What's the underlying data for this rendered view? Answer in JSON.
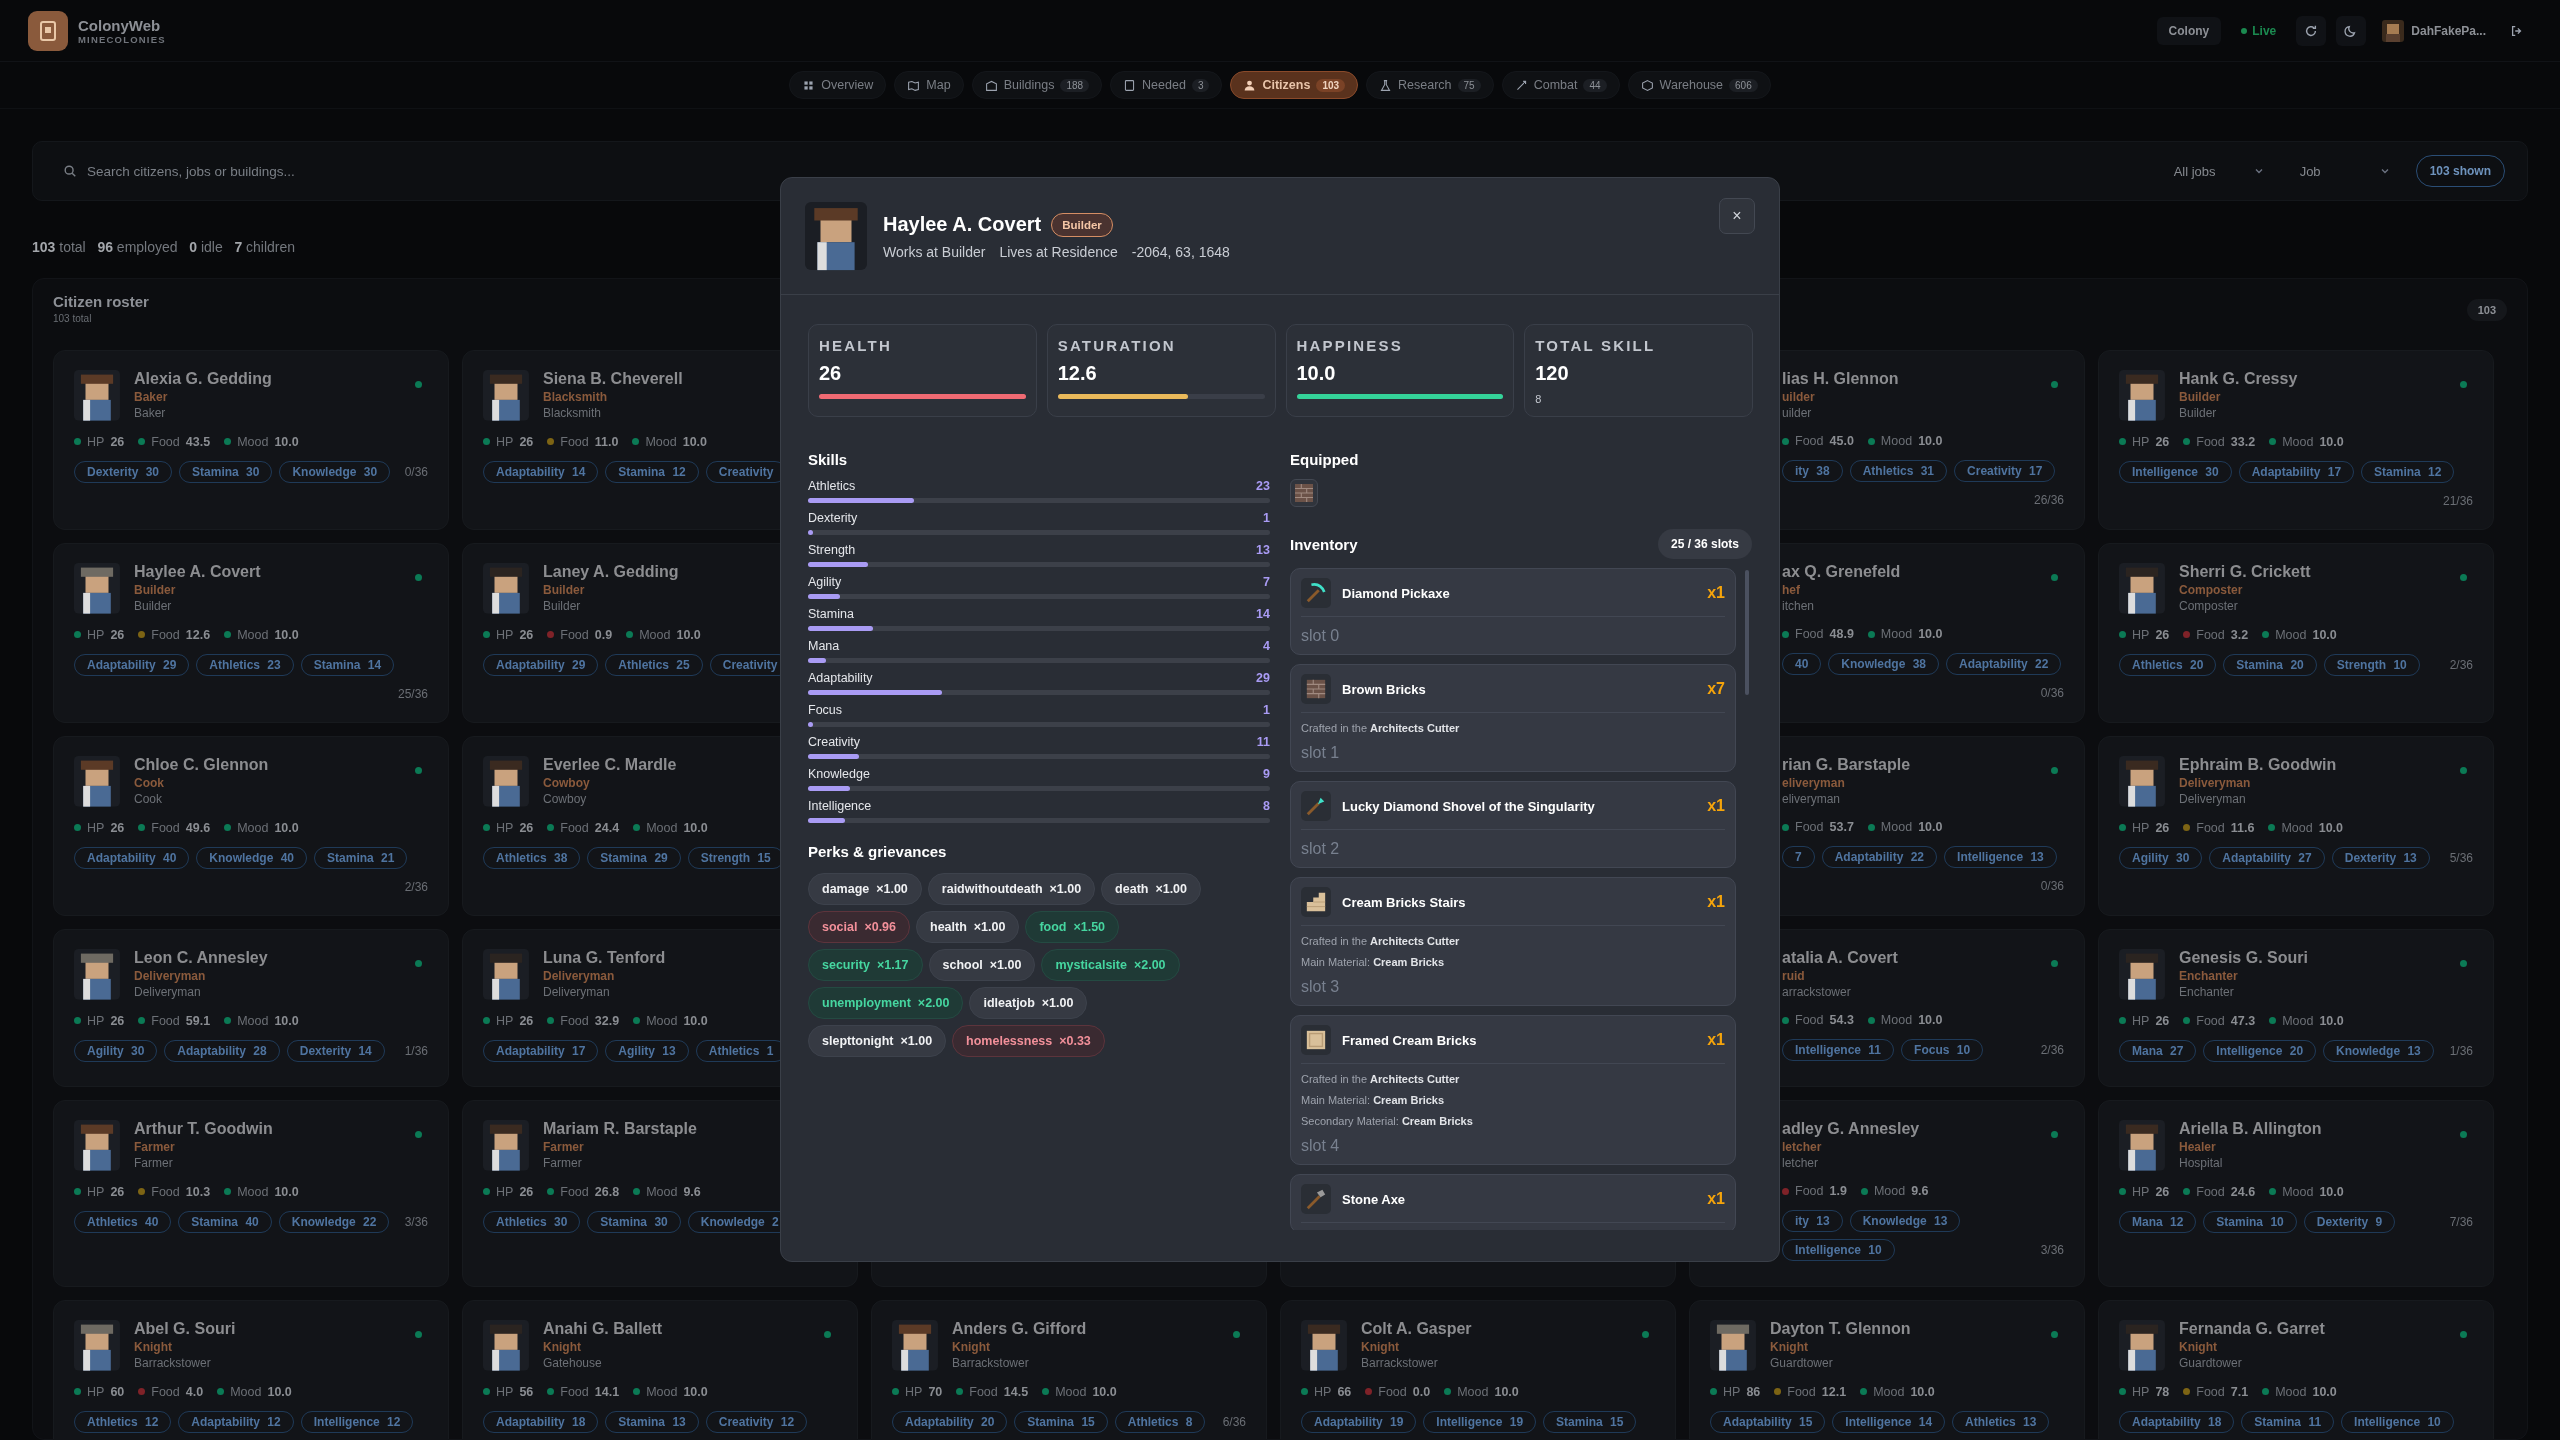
{
  "app": {
    "name": "ColonyWeb",
    "subtitle": "MINECOLONIES"
  },
  "header_actions": {
    "colony": "Colony",
    "live": "Live",
    "user": "DahFakePa..."
  },
  "nav": {
    "tabs": [
      {
        "label": "Overview",
        "selected": false
      },
      {
        "label": "Map",
        "selected": false
      },
      {
        "label": "Buildings",
        "count": "188",
        "selected": false
      },
      {
        "label": "Needed",
        "count": "3",
        "selected": false
      },
      {
        "label": "Citizens",
        "count": "103",
        "selected": true
      },
      {
        "label": "Research",
        "count": "75",
        "selected": false
      },
      {
        "label": "Combat",
        "count": "44",
        "selected": false
      },
      {
        "label": "Warehouse",
        "count": "606",
        "selected": false
      }
    ]
  },
  "search": {
    "placeholder": "Search citizens, jobs or buildings...",
    "filters": [
      "All jobs",
      "Job"
    ],
    "shown": "103 shown"
  },
  "summary": "**103** total   **96** employed   **0** idle   **7** children",
  "roster": {
    "title": "Citizen roster",
    "subtitle": "103 total",
    "count": "103",
    "cards": [
      {
        "kind": "full",
        "name": "Alexia G. Gedding",
        "role": "Baker",
        "place": "Baker",
        "online": true,
        "stats": [
          {
            "label": "HP",
            "value": "26",
            "color": "#0b7a55"
          },
          {
            "label": "Food",
            "value": "43.5",
            "color": "#0b7a55"
          },
          {
            "label": "Mood",
            "value": "10.0",
            "color": "#0b7a55"
          }
        ],
        "chips": [
          "Dexterity 30",
          "Stamina 30",
          "Knowledge 30"
        ],
        "slots": "0/36"
      },
      {
        "kind": "full",
        "name": "Siena B. Cheverell",
        "role": "Blacksmith",
        "place": "Blacksmith",
        "stats": [
          {
            "label": "HP",
            "value": "26",
            "color": "#0b7a55"
          },
          {
            "label": "Food",
            "value": "11.0",
            "color": "#7d6414"
          },
          {
            "label": "Mood",
            "value": "10.0",
            "color": "#0b7a55"
          }
        ],
        "chips": [
          "Adaptability 14",
          "Stamina 12",
          "Creativity"
        ]
      },
      {
        "kind": "covered"
      },
      {
        "kind": "covered"
      },
      {
        "kind": "cut-left",
        "name": "lias H. Glennon",
        "role": "uilder",
        "place": "uilder",
        "online": true,
        "stats": [
          {
            "label": "Food",
            "value": "45.0",
            "color": "#0b7a55"
          },
          {
            "label": "Mood",
            "value": "10.0",
            "color": "#0b7a55"
          }
        ],
        "chips": [
          "ity 38",
          "Athletics 31",
          "Creativity 17"
        ],
        "slots": "26/36"
      },
      {
        "kind": "full",
        "name": "Hank G. Cressy",
        "role": "Builder",
        "place": "Builder",
        "online": true,
        "stats": [
          {
            "label": "HP",
            "value": "26",
            "color": "#0b7a55"
          },
          {
            "label": "Food",
            "value": "33.2",
            "color": "#0b7a55"
          },
          {
            "label": "Mood",
            "value": "10.0",
            "color": "#0b7a55"
          }
        ],
        "chips": [
          "Intelligence 30",
          "Adaptability 17",
          "Stamina 12"
        ],
        "slots": "21/36"
      },
      {
        "kind": "full",
        "name": "Haylee A. Covert",
        "role": "Builder",
        "place": "Builder",
        "online": true,
        "stats": [
          {
            "label": "HP",
            "value": "26",
            "color": "#0b7a55"
          },
          {
            "label": "Food",
            "value": "12.6",
            "color": "#7d6414"
          },
          {
            "label": "Mood",
            "value": "10.0",
            "color": "#0b7a55"
          }
        ],
        "chips": [
          "Adaptability 29",
          "Athletics 23",
          "Stamina 14"
        ],
        "slots": "25/36"
      },
      {
        "kind": "full",
        "name": "Laney A. Gedding",
        "role": "Builder",
        "place": "Builder",
        "stats": [
          {
            "label": "HP",
            "value": "26",
            "color": "#0b7a55"
          },
          {
            "label": "Food",
            "value": "0.9",
            "color": "#7f2228"
          },
          {
            "label": "Mood",
            "value": "10.0",
            "color": "#0b7a55"
          }
        ],
        "chips": [
          "Adaptability 29",
          "Athletics 25",
          "Creativity"
        ]
      },
      {
        "kind": "covered"
      },
      {
        "kind": "covered"
      },
      {
        "kind": "cut-left",
        "name": "ax Q. Grenefeld",
        "role": "hef",
        "place": "itchen",
        "online": true,
        "stats": [
          {
            "label": "Food",
            "value": "48.9",
            "color": "#0b7a55"
          },
          {
            "label": "Mood",
            "value": "10.0",
            "color": "#0b7a55"
          }
        ],
        "chips": [
          "40",
          "Knowledge 38",
          "Adaptability 22"
        ],
        "slots": "0/36"
      },
      {
        "kind": "full",
        "name": "Sherri G. Crickett",
        "role": "Composter",
        "place": "Composter",
        "online": true,
        "stats": [
          {
            "label": "HP",
            "value": "26",
            "color": "#0b7a55"
          },
          {
            "label": "Food",
            "value": "3.2",
            "color": "#7f2228"
          },
          {
            "label": "Mood",
            "value": "10.0",
            "color": "#0b7a55"
          }
        ],
        "chips": [
          "Athletics 20",
          "Stamina 20",
          "Strength 10"
        ],
        "slots": "2/36"
      },
      {
        "kind": "full",
        "name": "Chloe C. Glennon",
        "role": "Cook",
        "place": "Cook",
        "online": true,
        "stats": [
          {
            "label": "HP",
            "value": "26",
            "color": "#0b7a55"
          },
          {
            "label": "Food",
            "value": "49.6",
            "color": "#0b7a55"
          },
          {
            "label": "Mood",
            "value": "10.0",
            "color": "#0b7a55"
          }
        ],
        "chips": [
          "Adaptability 40",
          "Knowledge 40",
          "Stamina 21"
        ],
        "slots": "2/36"
      },
      {
        "kind": "full",
        "name": "Everlee C. Mardle",
        "role": "Cowboy",
        "place": "Cowboy",
        "stats": [
          {
            "label": "HP",
            "value": "26",
            "color": "#0b7a55"
          },
          {
            "label": "Food",
            "value": "24.4",
            "color": "#0b7a55"
          },
          {
            "label": "Mood",
            "value": "10.0",
            "color": "#0b7a55"
          }
        ],
        "chips": [
          "Athletics 38",
          "Stamina 29",
          "Strength 15"
        ]
      },
      {
        "kind": "covered"
      },
      {
        "kind": "covered"
      },
      {
        "kind": "cut-left",
        "name": "rian G. Barstaple",
        "role": "eliveryman",
        "place": "eliveryman",
        "online": true,
        "stats": [
          {
            "label": "Food",
            "value": "53.7",
            "color": "#0b7a55"
          },
          {
            "label": "Mood",
            "value": "10.0",
            "color": "#0b7a55"
          }
        ],
        "chips": [
          "7",
          "Adaptability 22",
          "Intelligence 13"
        ],
        "slots": "0/36"
      },
      {
        "kind": "full",
        "name": "Ephraim B. Goodwin",
        "role": "Deliveryman",
        "place": "Deliveryman",
        "online": true,
        "stats": [
          {
            "label": "HP",
            "value": "26",
            "color": "#0b7a55"
          },
          {
            "label": "Food",
            "value": "11.6",
            "color": "#7d6414"
          },
          {
            "label": "Mood",
            "value": "10.0",
            "color": "#0b7a55"
          }
        ],
        "chips": [
          "Agility 30",
          "Adaptability 27",
          "Dexterity 13"
        ],
        "slots": "5/36"
      },
      {
        "kind": "full",
        "name": "Leon C. Annesley",
        "role": "Deliveryman",
        "place": "Deliveryman",
        "online": true,
        "stats": [
          {
            "label": "HP",
            "value": "26",
            "color": "#0b7a55"
          },
          {
            "label": "Food",
            "value": "59.1",
            "color": "#0b7a55"
          },
          {
            "label": "Mood",
            "value": "10.0",
            "color": "#0b7a55"
          }
        ],
        "chips": [
          "Agility 30",
          "Adaptability 28",
          "Dexterity 14"
        ],
        "slots": "1/36"
      },
      {
        "kind": "full",
        "name": "Luna G. Tenford",
        "role": "Deliveryman",
        "place": "Deliveryman",
        "stats": [
          {
            "label": "HP",
            "value": "26",
            "color": "#0b7a55"
          },
          {
            "label": "Food",
            "value": "32.9",
            "color": "#0b7a55"
          },
          {
            "label": "Mood",
            "value": "10.0",
            "color": "#0b7a55"
          }
        ],
        "chips": [
          "Adaptability 17",
          "Agility 13",
          "Athletics 1"
        ]
      },
      {
        "kind": "covered"
      },
      {
        "kind": "covered"
      },
      {
        "kind": "cut-left",
        "name": "atalia A. Covert",
        "role": "ruid",
        "place": "arrackstower",
        "online": true,
        "stats": [
          {
            "label": "Food",
            "value": "54.3",
            "color": "#0b7a55"
          },
          {
            "label": "Mood",
            "value": "10.0",
            "color": "#0b7a55"
          }
        ],
        "chips": [
          "Intelligence 11",
          "Focus 10"
        ],
        "slots": "2/36"
      },
      {
        "kind": "full",
        "name": "Genesis G. Souri",
        "role": "Enchanter",
        "place": "Enchanter",
        "online": true,
        "stats": [
          {
            "label": "HP",
            "value": "26",
            "color": "#0b7a55"
          },
          {
            "label": "Food",
            "value": "47.3",
            "color": "#0b7a55"
          },
          {
            "label": "Mood",
            "value": "10.0",
            "color": "#0b7a55"
          }
        ],
        "chips": [
          "Mana 27",
          "Intelligence 20",
          "Knowledge 13"
        ],
        "slots": "1/36"
      },
      {
        "kind": "full",
        "name": "Arthur T. Goodwin",
        "role": "Farmer",
        "place": "Farmer",
        "online": true,
        "stats": [
          {
            "label": "HP",
            "value": "26",
            "color": "#0b7a55"
          },
          {
            "label": "Food",
            "value": "10.3",
            "color": "#7d6414"
          },
          {
            "label": "Mood",
            "value": "10.0",
            "color": "#0b7a55"
          }
        ],
        "chips": [
          "Athletics 40",
          "Stamina 40",
          "Knowledge 22"
        ],
        "slots": "3/36"
      },
      {
        "kind": "full",
        "name": "Mariam R. Barstaple",
        "role": "Farmer",
        "place": "Farmer",
        "stats": [
          {
            "label": "HP",
            "value": "26",
            "color": "#0b7a55"
          },
          {
            "label": "Food",
            "value": "26.8",
            "color": "#0b7a55"
          },
          {
            "label": "Mood",
            "value": "9.6",
            "color": "#0b7a55"
          }
        ],
        "chips": [
          "Athletics 30",
          "Stamina 30",
          "Knowledge 2"
        ]
      },
      {
        "kind": "stub"
      },
      {
        "kind": "stub"
      },
      {
        "kind": "cut-left",
        "name": "adley G. Annesley",
        "role": "letcher",
        "place": "letcher",
        "online": true,
        "stats": [
          {
            "label": "Food",
            "value": "1.9",
            "color": "#7f2228"
          },
          {
            "label": "Mood",
            "value": "9.6",
            "color": "#0b7a55"
          }
        ],
        "chips": [
          "ity 13",
          "Knowledge 13",
          "Intelligence 10"
        ],
        "slots": "3/36"
      },
      {
        "kind": "full",
        "name": "Ariella B. Allington",
        "role": "Healer",
        "place": "Hospital",
        "online": true,
        "stats": [
          {
            "label": "HP",
            "value": "26",
            "color": "#0b7a55"
          },
          {
            "label": "Food",
            "value": "24.6",
            "color": "#0b7a55"
          },
          {
            "label": "Mood",
            "value": "10.0",
            "color": "#0b7a55"
          }
        ],
        "chips": [
          "Mana 12",
          "Stamina 10",
          "Dexterity 9"
        ],
        "slots": "7/36"
      },
      {
        "kind": "full",
        "name": "Abel G. Souri",
        "role": "Knight",
        "place": "Barrackstower",
        "online": true,
        "stats": [
          {
            "label": "HP",
            "value": "60",
            "color": "#0b7a55"
          },
          {
            "label": "Food",
            "value": "4.0",
            "color": "#7f2228"
          },
          {
            "label": "Mood",
            "value": "10.0",
            "color": "#0b7a55"
          }
        ],
        "chips": [
          "Athletics 12",
          "Adaptability 12",
          "Intelligence 12"
        ]
      },
      {
        "kind": "full",
        "name": "Anahi G. Ballett",
        "role": "Knight",
        "place": "Gatehouse",
        "online": true,
        "stats": [
          {
            "label": "HP",
            "value": "56",
            "color": "#0b7a55"
          },
          {
            "label": "Food",
            "value": "14.1",
            "color": "#0b7a55"
          },
          {
            "label": "Mood",
            "value": "10.0",
            "color": "#0b7a55"
          }
        ],
        "chips": [
          "Adaptability 18",
          "Stamina 13",
          "Creativity 12"
        ]
      },
      {
        "kind": "full",
        "name": "Anders G. Gifford",
        "role": "Knight",
        "place": "Barrackstower",
        "online": true,
        "stats": [
          {
            "label": "HP",
            "value": "70",
            "color": "#0b7a55"
          },
          {
            "label": "Food",
            "value": "14.5",
            "color": "#0b7a55"
          },
          {
            "label": "Mood",
            "value": "10.0",
            "color": "#0b7a55"
          }
        ],
        "chips": [
          "Adaptability 20",
          "Stamina 15",
          "Athletics 8"
        ],
        "slots": "6/36"
      },
      {
        "kind": "full",
        "name": "Colt A. Gasper",
        "role": "Knight",
        "place": "Barrackstower",
        "online": true,
        "stats": [
          {
            "label": "HP",
            "value": "66",
            "color": "#0b7a55"
          },
          {
            "label": "Food",
            "value": "0.0",
            "color": "#7f2228"
          },
          {
            "label": "Mood",
            "value": "10.0",
            "color": "#0b7a55"
          }
        ],
        "chips": [
          "Adaptability 19",
          "Intelligence 19",
          "Stamina 15"
        ]
      },
      {
        "kind": "full",
        "name": "Dayton T. Glennon",
        "role": "Knight",
        "place": "Guardtower",
        "online": true,
        "stats": [
          {
            "label": "HP",
            "value": "86",
            "color": "#0b7a55"
          },
          {
            "label": "Food",
            "value": "12.1",
            "color": "#7d6414"
          },
          {
            "label": "Mood",
            "value": "10.0",
            "color": "#0b7a55"
          }
        ],
        "chips": [
          "Adaptability 15",
          "Intelligence 14",
          "Athletics 13"
        ]
      },
      {
        "kind": "full",
        "name": "Fernanda G. Garret",
        "role": "Knight",
        "place": "Guardtower",
        "online": true,
        "stats": [
          {
            "label": "HP",
            "value": "78",
            "color": "#0b7a55"
          },
          {
            "label": "Food",
            "value": "7.1",
            "color": "#7d6414"
          },
          {
            "label": "Mood",
            "value": "10.0",
            "color": "#0b7a55"
          }
        ],
        "chips": [
          "Adaptability 18",
          "Stamina 11",
          "Intelligence 10"
        ]
      }
    ]
  },
  "citizen": {
    "name": "Haylee A. Covert",
    "badge": "Builder",
    "work": "Works at Builder",
    "home": "Lives at Residence",
    "coords": "-2064, 63, 1648",
    "close": "×",
    "stats": [
      {
        "label": "HEALTH",
        "value": "26",
        "level": 1.0,
        "color": "#f06a73"
      },
      {
        "label": "SATURATION",
        "value": "12.6",
        "level": 0.63,
        "color": "#eab95a"
      },
      {
        "label": "HAPPINESS",
        "value": "10.0",
        "level": 1.0,
        "color": "#34d399"
      },
      {
        "label": "TOTAL SKILL",
        "value": "120",
        "note": "8"
      }
    ],
    "skills_title": "Skills",
    "skills": [
      {
        "name": "Athletics",
        "value": "23",
        "level": 0.23
      },
      {
        "name": "Dexterity",
        "value": "1",
        "level": 0.01
      },
      {
        "name": "Strength",
        "value": "13",
        "level": 0.13
      },
      {
        "name": "Agility",
        "value": "7",
        "level": 0.07
      },
      {
        "name": "Stamina",
        "value": "14",
        "level": 0.14
      },
      {
        "name": "Mana",
        "value": "4",
        "level": 0.04
      },
      {
        "name": "Adaptability",
        "value": "29",
        "level": 0.29
      },
      {
        "name": "Focus",
        "value": "1",
        "level": 0.01
      },
      {
        "name": "Creativity",
        "value": "11",
        "level": 0.11
      },
      {
        "name": "Knowledge",
        "value": "9",
        "level": 0.09
      },
      {
        "name": "Intelligence",
        "value": "8",
        "level": 0.08
      }
    ],
    "perks_title": "Perks & grievances",
    "perks": [
      {
        "name": "damage",
        "value": "×1.00",
        "kind": "neutral"
      },
      {
        "name": "raidwithoutdeath",
        "value": "×1.00",
        "kind": "neutral"
      },
      {
        "name": "death",
        "value": "×1.00",
        "kind": "neutral"
      },
      {
        "name": "social",
        "value": "×0.96",
        "kind": "negative"
      },
      {
        "name": "health",
        "value": "×1.00",
        "kind": "neutral"
      },
      {
        "name": "food",
        "value": "×1.50",
        "kind": "positive"
      },
      {
        "name": "security",
        "value": "×1.17",
        "kind": "positive"
      },
      {
        "name": "school",
        "value": "×1.00",
        "kind": "neutral"
      },
      {
        "name": "mysticalsite",
        "value": "×2.00",
        "kind": "positive"
      },
      {
        "name": "unemployment",
        "value": "×2.00",
        "kind": "positive"
      },
      {
        "name": "idleatjob",
        "value": "×1.00",
        "kind": "neutral"
      },
      {
        "name": "slepttonight",
        "value": "×1.00",
        "kind": "neutral"
      },
      {
        "name": "homelessness",
        "value": "×0.33",
        "kind": "negative"
      }
    ],
    "equipped_title": "Equipped",
    "inventory_title": "Inventory",
    "inventory_slots": "25 / 36 slots",
    "inventory": [
      {
        "name": "Diamond Pickaxe",
        "qty": "x1",
        "slot": "slot 0"
      },
      {
        "name": "Brown Bricks",
        "qty": "x7",
        "details": [
          "Crafted in the **Architects Cutter**"
        ],
        "slot": "slot 1"
      },
      {
        "name": "Lucky Diamond Shovel of the Singularity",
        "qty": "x1",
        "slot": "slot 2"
      },
      {
        "name": "Cream Bricks Stairs",
        "qty": "x1",
        "details": [
          "Crafted in the **Architects Cutter**",
          "Main Material: **Cream Bricks**"
        ],
        "slot": "slot 3"
      },
      {
        "name": "Framed Cream Bricks",
        "qty": "x1",
        "details": [
          "Crafted in the **Architects Cutter**",
          "Main Material: **Cream Bricks**",
          "Secondary Material: **Cream Bricks**"
        ],
        "slot": "slot 4"
      },
      {
        "name": "Stone Axe",
        "qty": "x1"
      }
    ]
  }
}
